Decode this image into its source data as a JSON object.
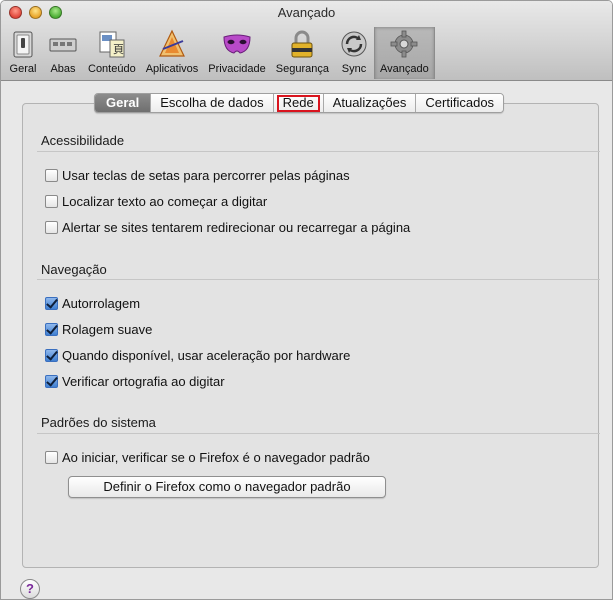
{
  "window": {
    "title": "Avançado"
  },
  "toolbar": {
    "items": [
      {
        "label": "Geral",
        "icon": "switch-icon"
      },
      {
        "label": "Abas",
        "icon": "tabs-icon"
      },
      {
        "label": "Conteúdo",
        "icon": "content-icon"
      },
      {
        "label": "Aplicativos",
        "icon": "applications-icon"
      },
      {
        "label": "Privacidade",
        "icon": "privacy-mask-icon"
      },
      {
        "label": "Segurança",
        "icon": "lock-icon"
      },
      {
        "label": "Sync",
        "icon": "sync-icon"
      },
      {
        "label": "Avançado",
        "icon": "gear-icon",
        "selected": true
      }
    ]
  },
  "tabs": [
    {
      "label": "Geral",
      "active": true
    },
    {
      "label": "Escolha de dados"
    },
    {
      "label": "Rede",
      "highlighted": true
    },
    {
      "label": "Atualizações"
    },
    {
      "label": "Certificados"
    }
  ],
  "sections": {
    "accessibility": {
      "title": "Acessibilidade",
      "options": [
        {
          "label": "Usar teclas de setas para percorrer pelas páginas",
          "checked": false
        },
        {
          "label": "Localizar texto ao começar a digitar",
          "checked": false
        },
        {
          "label": "Alertar se sites tentarem redirecionar ou recarregar a página",
          "checked": false
        }
      ]
    },
    "navigation": {
      "title": "Navegação",
      "options": [
        {
          "label": "Autorrolagem",
          "checked": true
        },
        {
          "label": "Rolagem suave",
          "checked": true
        },
        {
          "label": "Quando disponível, usar aceleração por hardware",
          "checked": true
        },
        {
          "label": "Verificar ortografia ao digitar",
          "checked": true
        }
      ]
    },
    "system": {
      "title": "Padrões do sistema",
      "options": [
        {
          "label": "Ao iniciar, verificar se o Firefox é o navegador padrão",
          "checked": false
        }
      ],
      "button_label": "Definir o Firefox como o navegador padrão"
    }
  },
  "help": {
    "label": "?"
  },
  "colors": {
    "highlight_border": "#d9141e",
    "checkbox_checked": "#3f7fd1",
    "active_tab": "#7a7a7a"
  }
}
